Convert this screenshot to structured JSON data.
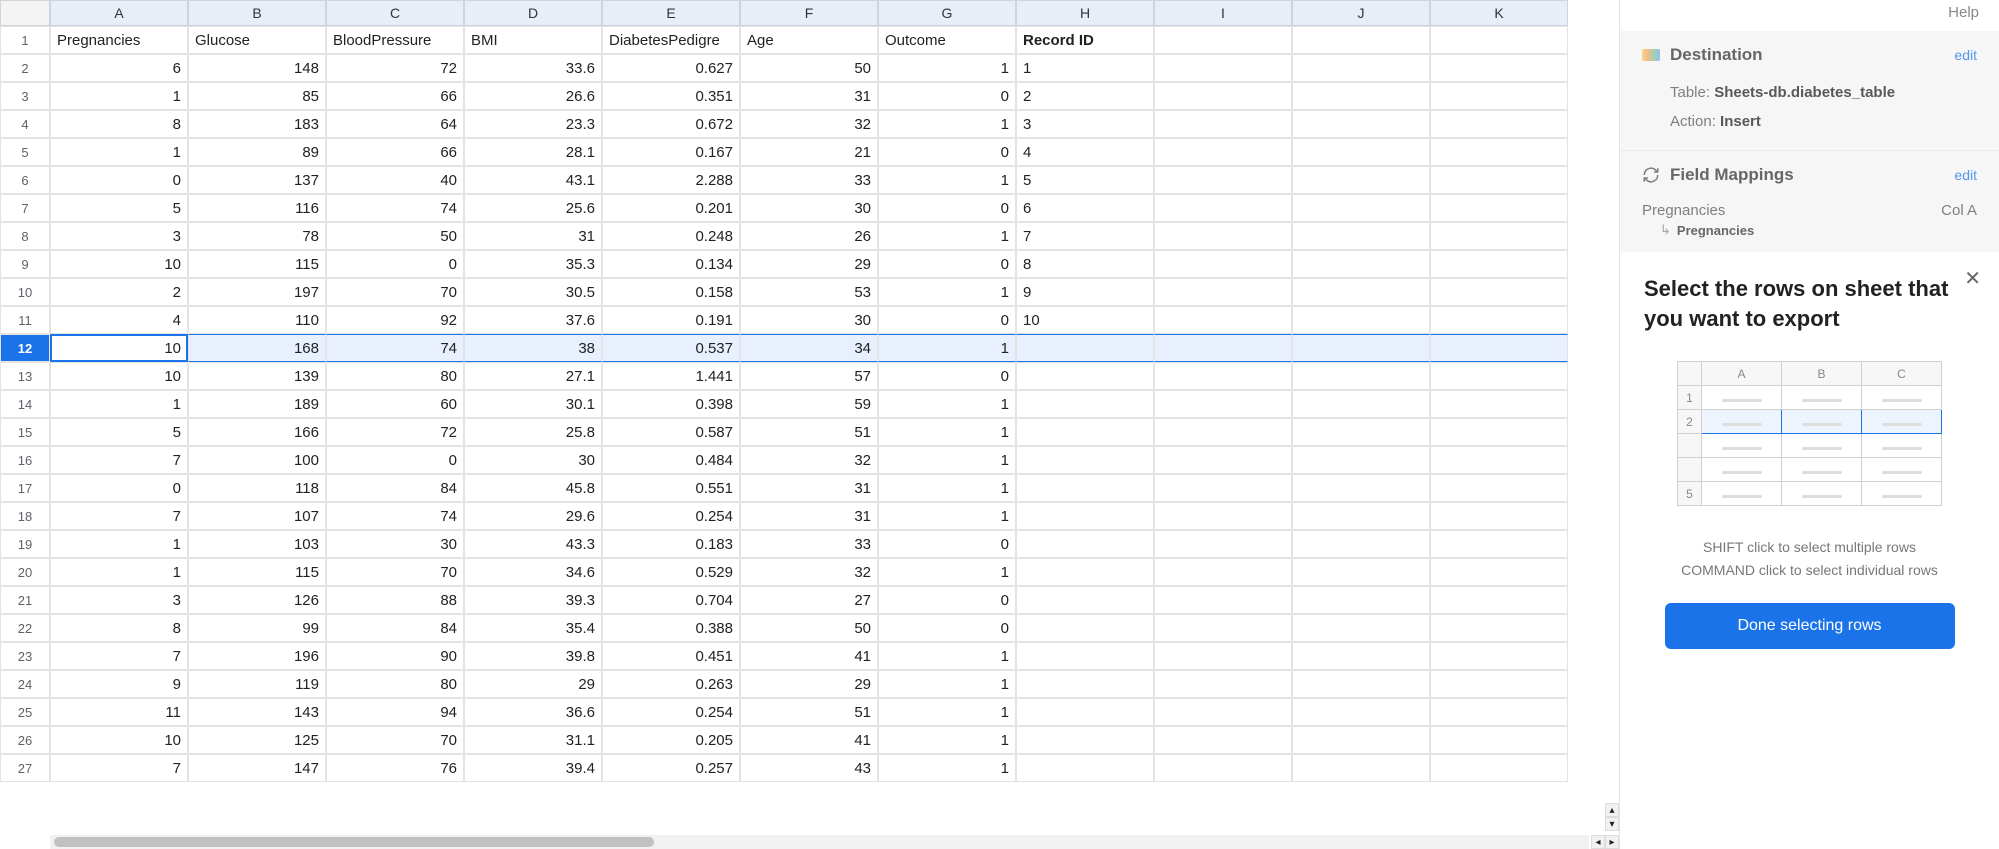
{
  "columns": [
    "A",
    "B",
    "C",
    "D",
    "E",
    "F",
    "G",
    "H",
    "I",
    "J",
    "K"
  ],
  "headers": [
    "Pregnancies",
    "Glucose",
    "BloodPressure",
    "BMI",
    "DiabetesPedigre",
    "Age",
    "Outcome",
    "Record ID"
  ],
  "header_bold_col": 7,
  "selected_row": 12,
  "active_cell_col": 0,
  "rows": [
    [
      6,
      148,
      72,
      33.6,
      0.627,
      50,
      1,
      "1"
    ],
    [
      1,
      85,
      66,
      26.6,
      0.351,
      31,
      0,
      "2"
    ],
    [
      8,
      183,
      64,
      23.3,
      0.672,
      32,
      1,
      "3"
    ],
    [
      1,
      89,
      66,
      28.1,
      0.167,
      21,
      0,
      "4"
    ],
    [
      0,
      137,
      40,
      43.1,
      2.288,
      33,
      1,
      "5"
    ],
    [
      5,
      116,
      74,
      25.6,
      0.201,
      30,
      0,
      "6"
    ],
    [
      3,
      78,
      50,
      31,
      0.248,
      26,
      1,
      "7"
    ],
    [
      10,
      115,
      0,
      35.3,
      0.134,
      29,
      0,
      "8"
    ],
    [
      2,
      197,
      70,
      30.5,
      0.158,
      53,
      1,
      "9"
    ],
    [
      4,
      110,
      92,
      37.6,
      0.191,
      30,
      0,
      "10"
    ],
    [
      10,
      168,
      74,
      38,
      0.537,
      34,
      1,
      ""
    ],
    [
      10,
      139,
      80,
      27.1,
      1.441,
      57,
      0,
      ""
    ],
    [
      1,
      189,
      60,
      30.1,
      0.398,
      59,
      1,
      ""
    ],
    [
      5,
      166,
      72,
      25.8,
      0.587,
      51,
      1,
      ""
    ],
    [
      7,
      100,
      0,
      30,
      0.484,
      32,
      1,
      ""
    ],
    [
      0,
      118,
      84,
      45.8,
      0.551,
      31,
      1,
      ""
    ],
    [
      7,
      107,
      74,
      29.6,
      0.254,
      31,
      1,
      ""
    ],
    [
      1,
      103,
      30,
      43.3,
      0.183,
      33,
      0,
      ""
    ],
    [
      1,
      115,
      70,
      34.6,
      0.529,
      32,
      1,
      ""
    ],
    [
      3,
      126,
      88,
      39.3,
      0.704,
      27,
      0,
      ""
    ],
    [
      8,
      99,
      84,
      35.4,
      0.388,
      50,
      0,
      ""
    ],
    [
      7,
      196,
      90,
      39.8,
      0.451,
      41,
      1,
      ""
    ],
    [
      9,
      119,
      80,
      29,
      0.263,
      29,
      1,
      ""
    ],
    [
      11,
      143,
      94,
      36.6,
      0.254,
      51,
      1,
      ""
    ],
    [
      10,
      125,
      70,
      31.1,
      0.205,
      41,
      1,
      ""
    ],
    [
      7,
      147,
      76,
      39.4,
      0.257,
      43,
      1,
      ""
    ]
  ],
  "sidebar": {
    "help": "Help",
    "destination": {
      "title": "Destination",
      "edit": "edit",
      "table_label": "Table:",
      "table_value": "Sheets-db.diabetes_table",
      "action_label": "Action:",
      "action_value": "Insert"
    },
    "mappings": {
      "title": "Field Mappings",
      "edit": "edit",
      "field": "Pregnancies",
      "col": "Col A",
      "target": "Pregnancies"
    },
    "popup": {
      "title": "Select the rows on sheet that you want to export",
      "illus_cols": [
        "A",
        "B",
        "C"
      ],
      "illus_rows": [
        "1",
        "2",
        "",
        "",
        "5"
      ],
      "hint1": "SHIFT click to select multiple rows",
      "hint2": "COMMAND click to select individual rows",
      "button": "Done selecting rows"
    }
  }
}
